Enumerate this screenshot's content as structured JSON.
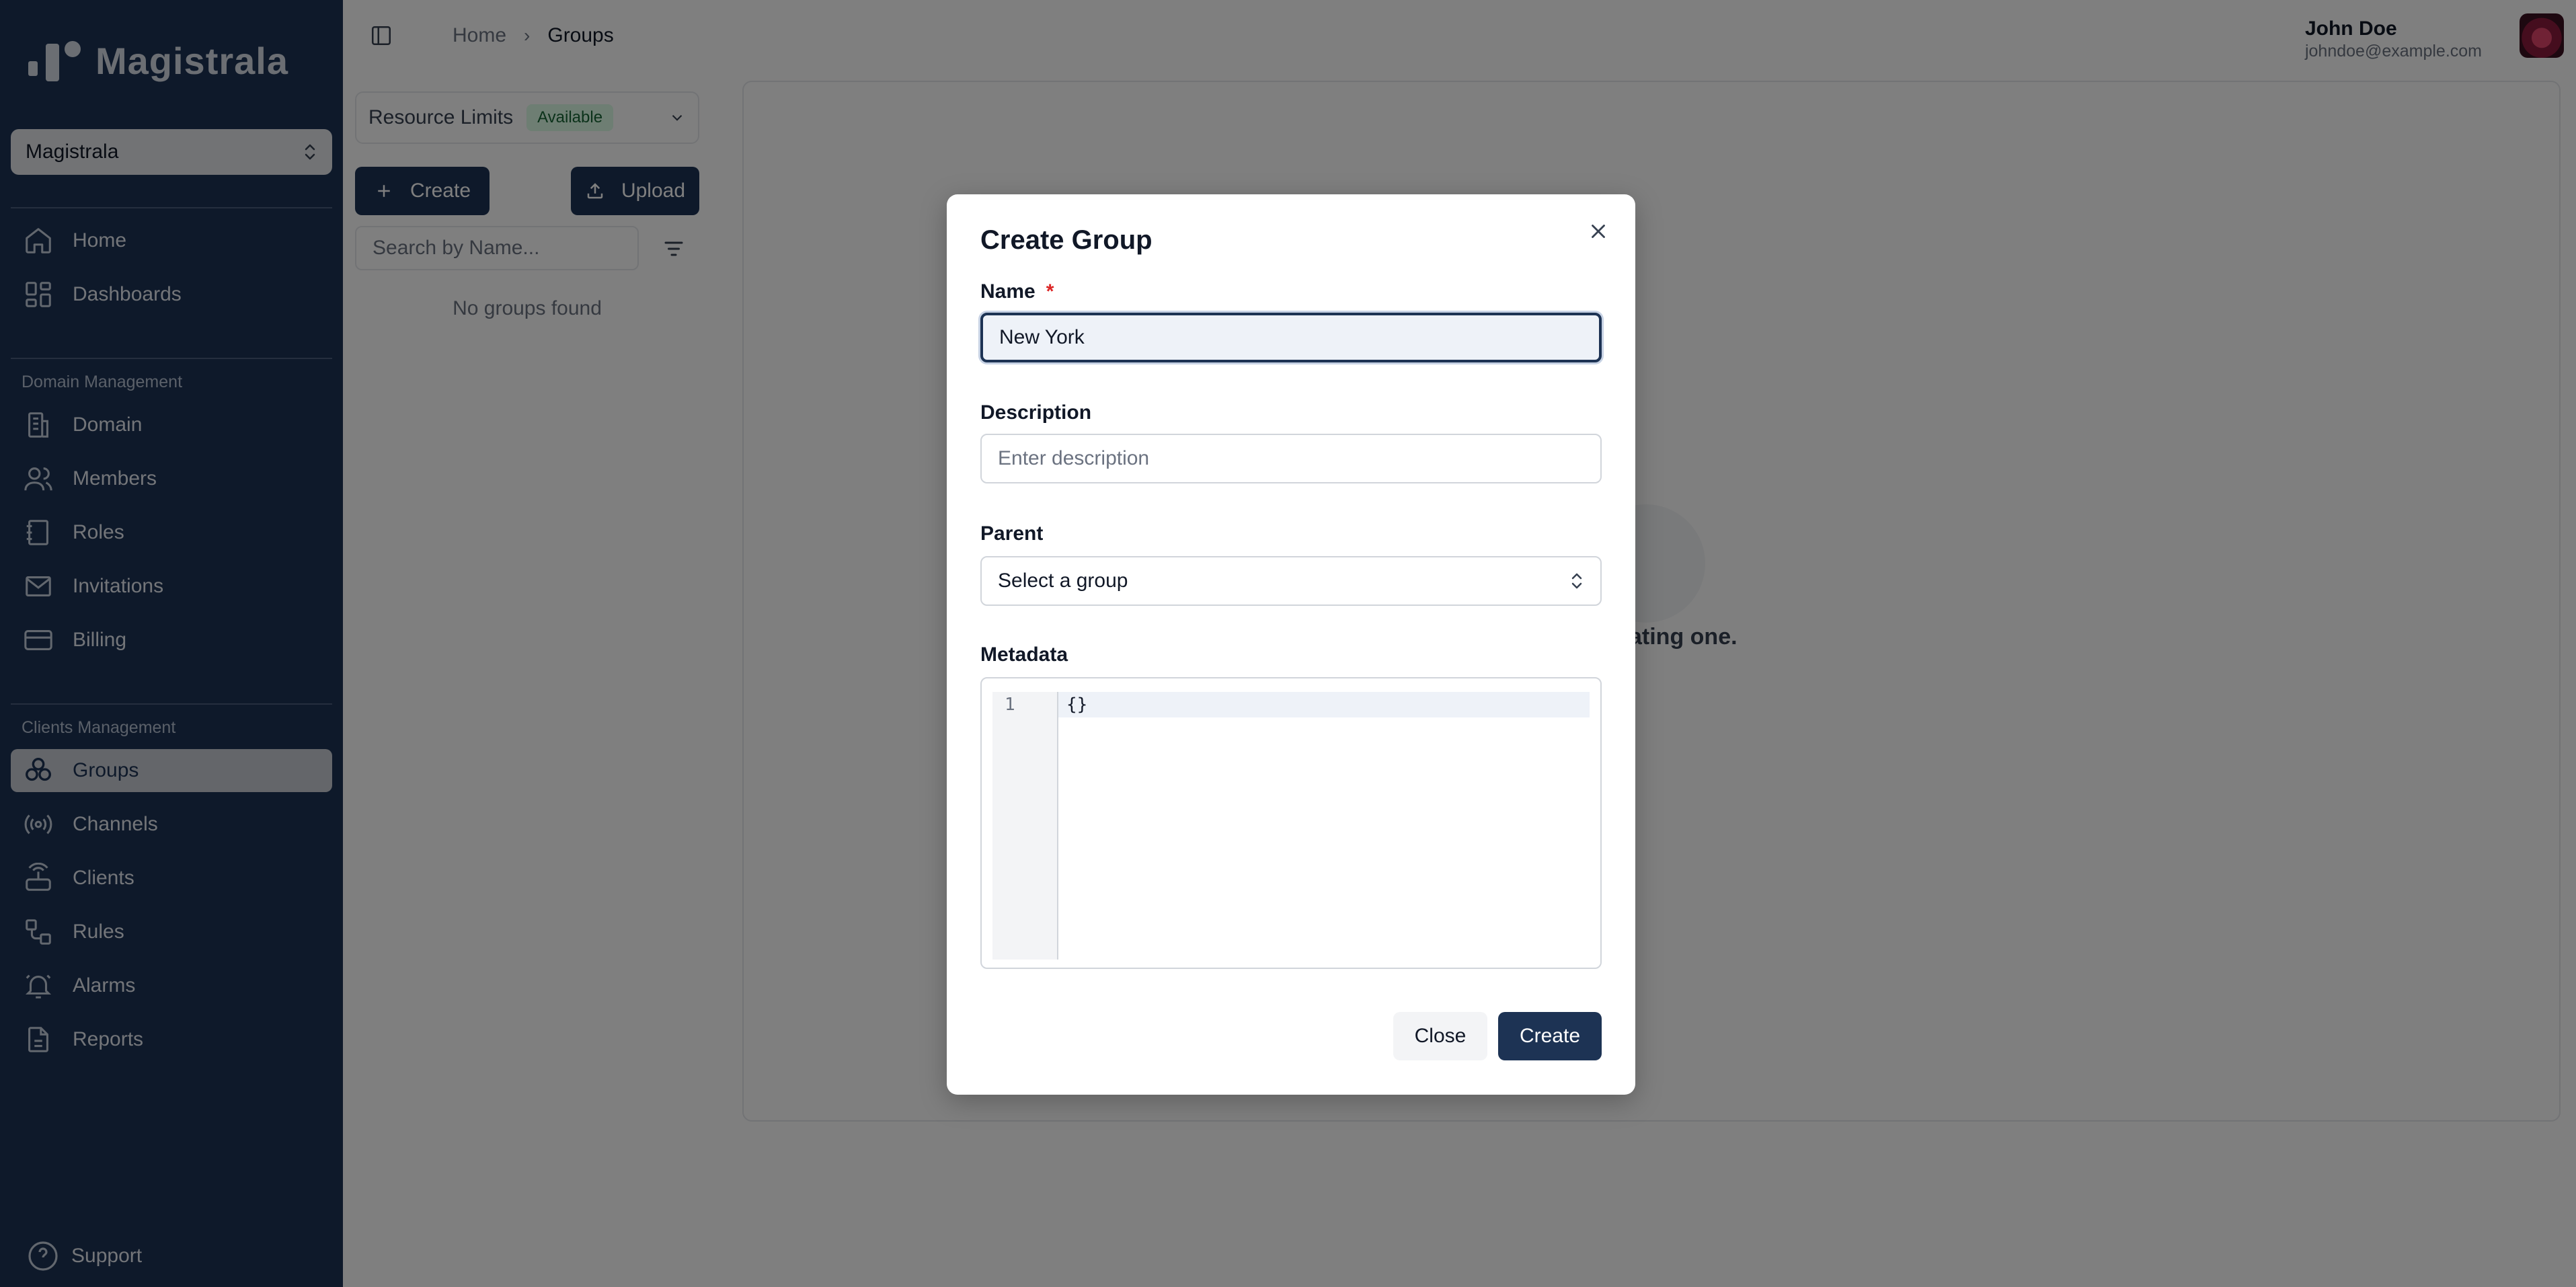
{
  "app": {
    "name": "Magistrala"
  },
  "sidebar": {
    "domain_selector": {
      "value": "Magistrala"
    },
    "top_items": [
      {
        "label": "Home",
        "icon": "home-icon"
      },
      {
        "label": "Dashboards",
        "icon": "dashboard-icon"
      }
    ],
    "domain_section": {
      "label": "Domain Management",
      "items": [
        {
          "label": "Domain",
          "icon": "building-icon"
        },
        {
          "label": "Members",
          "icon": "users-icon"
        },
        {
          "label": "Roles",
          "icon": "book-icon"
        },
        {
          "label": "Invitations",
          "icon": "mail-icon"
        },
        {
          "label": "Billing",
          "icon": "credit-card-icon"
        }
      ]
    },
    "clients_section": {
      "label": "Clients Management",
      "items": [
        {
          "label": "Groups",
          "icon": "groups-icon",
          "active": true
        },
        {
          "label": "Channels",
          "icon": "radio-icon"
        },
        {
          "label": "Clients",
          "icon": "router-icon"
        },
        {
          "label": "Rules",
          "icon": "workflow-icon"
        },
        {
          "label": "Alarms",
          "icon": "bell-icon"
        },
        {
          "label": "Reports",
          "icon": "file-icon"
        }
      ]
    },
    "support_label": "Support"
  },
  "header": {
    "breadcrumb": [
      "Home",
      "Groups"
    ],
    "user": {
      "name": "John Doe",
      "email": "johndoe@example.com"
    }
  },
  "groups_panel": {
    "resource_limits": {
      "label": "Resource Limits",
      "badge": "Available"
    },
    "create_label": "Create",
    "upload_label": "Upload",
    "search_placeholder": "Search by Name...",
    "empty_text": "No groups found"
  },
  "content": {
    "empty_text": "started by creating one."
  },
  "dialog": {
    "title": "Create Group",
    "name": {
      "label": "Name",
      "required_mark": "*",
      "value": "New York"
    },
    "description": {
      "label": "Description",
      "placeholder": "Enter description"
    },
    "parent": {
      "label": "Parent",
      "value": "Select a group"
    },
    "metadata": {
      "label": "Metadata",
      "line_number": "1",
      "code": "{}"
    },
    "close_label": "Close",
    "create_label": "Create"
  },
  "colors": {
    "sidebar_bg": "#1d3354",
    "primary": "#1d3354",
    "badge_bg": "#dcfce7",
    "badge_text": "#166534",
    "required": "#dc2626"
  }
}
